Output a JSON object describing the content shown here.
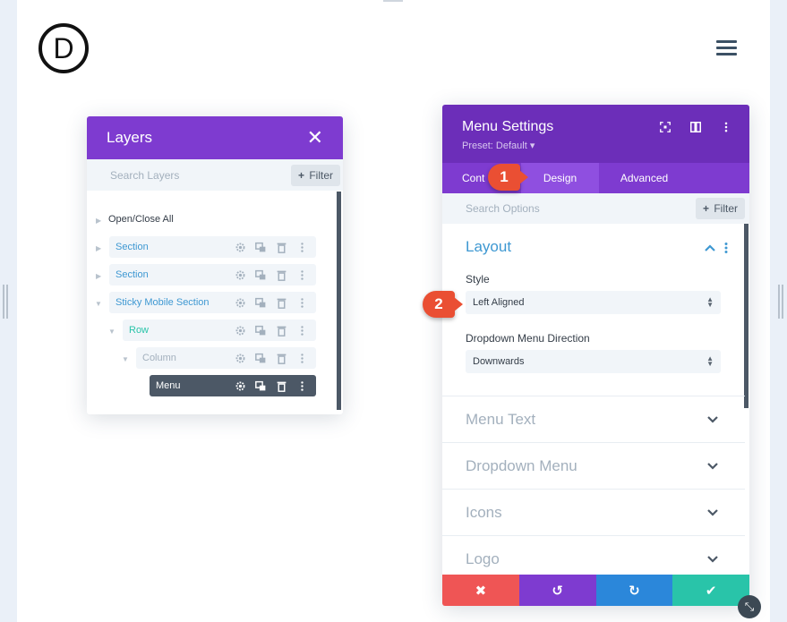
{
  "layers": {
    "title": "Layers",
    "close_glyph": "✕",
    "search_placeholder": "Search Layers",
    "filter_label": "Filter",
    "filter_plus": "+",
    "open_close_label": "Open/Close All",
    "items": [
      {
        "label": "Section",
        "color": "#3e98d2"
      },
      {
        "label": "Section",
        "color": "#3e98d2"
      },
      {
        "label": "Sticky Mobile Section",
        "color": "#3e98d2"
      },
      {
        "label": "Row",
        "color": "#29c4a9"
      },
      {
        "label": "Column",
        "color": "#a3b0bd"
      },
      {
        "label": "Menu",
        "color": "#ffffff"
      }
    ]
  },
  "settings": {
    "title": "Menu Settings",
    "preset": "Preset: Default ▾",
    "tabs": [
      "Content",
      "Design",
      "Advanced"
    ],
    "content_tab_visible": "Cont",
    "search_placeholder": "Search Options",
    "filter_label": "Filter",
    "filter_plus": "+",
    "layout": {
      "title": "Layout",
      "style_label": "Style",
      "style_value": "Left Aligned",
      "direction_label": "Dropdown Menu Direction",
      "direction_value": "Downwards"
    },
    "sections": [
      "Menu Text",
      "Dropdown Menu",
      "Icons",
      "Logo"
    ]
  },
  "footer": {
    "cancel": "✖",
    "undo": "↺",
    "redo": "↻",
    "save": "✔"
  },
  "badges": [
    "1",
    "2"
  ],
  "colors": {
    "purple_header": "#7e3bd0",
    "purple_dark": "#6c2eb9",
    "accent_blue": "#3e98d2",
    "badge_red": "#ea4f33",
    "footer_red": "#ef5555",
    "footer_purple": "#7e3bd0",
    "footer_blue": "#2b87da",
    "footer_green": "#29c4a9"
  }
}
